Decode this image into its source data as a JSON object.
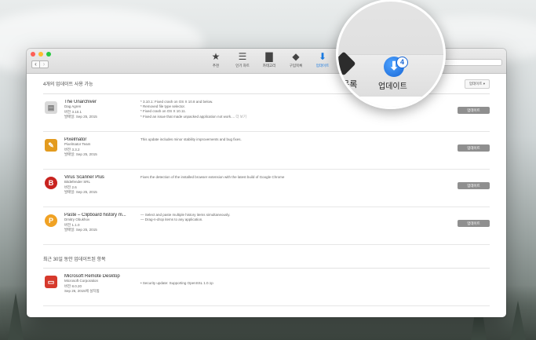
{
  "toolbar": {
    "tabs": [
      {
        "label": "추천",
        "icon": "star-icon",
        "glyph": "★"
      },
      {
        "label": "인기 차트",
        "icon": "list-icon",
        "glyph": "☰"
      },
      {
        "label": "카테고리",
        "icon": "box-icon",
        "glyph": "▇"
      },
      {
        "label": "구입목록",
        "icon": "tag-icon",
        "glyph": "◆"
      },
      {
        "label": "업데이트",
        "icon": "update-icon",
        "glyph": "⬇"
      }
    ]
  },
  "updates": {
    "title": "4개의 업데이트 사용 가능",
    "update_all_label": "업데이트 ▾",
    "items": [
      {
        "name": "The Unarchiver",
        "developer": "Dag Agren",
        "version": "버전 3.10.1",
        "date": "발매일: Sep 25, 2015",
        "notes": [
          "* 3.10.1: Fixed crash on OS X 10.8 and below.",
          "* Removed file type selector.",
          "* Fixed crash on OS X 10.11.",
          "* Fixed an issue that made unpacked application not work...."
        ],
        "more": "더 보기",
        "button": "업데이트",
        "icon_color": "#d9d9d9",
        "icon_glyph": "▤"
      },
      {
        "name": "Pixelmator",
        "developer": "Pixelmator Team",
        "version": "버전 3.3.2",
        "date": "발매일: Sep 25, 2015",
        "notes": [
          "This update includes minor stability improvements and bug fixes."
        ],
        "button": "업데이트",
        "icon_color": "#e39b1f",
        "icon_glyph": "✎"
      },
      {
        "name": "Virus Scanner Plus",
        "developer": "Bitdefender SRL",
        "version": "버전 2.6",
        "date": "발매일: Sep 25, 2015",
        "notes": [
          "Fixes the detection of the installed browser extension with the latest build of Google Chrome"
        ],
        "button": "업데이트",
        "icon_color": "#c8231f",
        "icon_glyph": "B"
      },
      {
        "name": "Paste – Clipboard history m...",
        "developer": "Dmitry Obukhov",
        "version": "버전 1.1.0",
        "date": "발매일: Sep 25, 2015",
        "notes": [
          "— Select and paste multiple history items simultaneously.",
          "— Drag-n-drop items to any application."
        ],
        "button": "업데이트",
        "icon_color": "#f0a224",
        "icon_glyph": "P"
      }
    ]
  },
  "recent": {
    "title": "최근 30일 동안 업데이트된 항목",
    "items": [
      {
        "name": "Microsoft Remote Desktop",
        "developer": "Microsoft Corporation",
        "version": "버전 8.0.20",
        "date": "Sep 26, 2015에 설치됨",
        "notes": [
          "• Security update: Supporting OpenSSL 1.0.1p"
        ],
        "icon_color": "#d6392c",
        "icon_glyph": "▭"
      }
    ]
  },
  "magnifier": {
    "label_left": "입목록",
    "label_right": "업데이트",
    "badge": "4"
  }
}
